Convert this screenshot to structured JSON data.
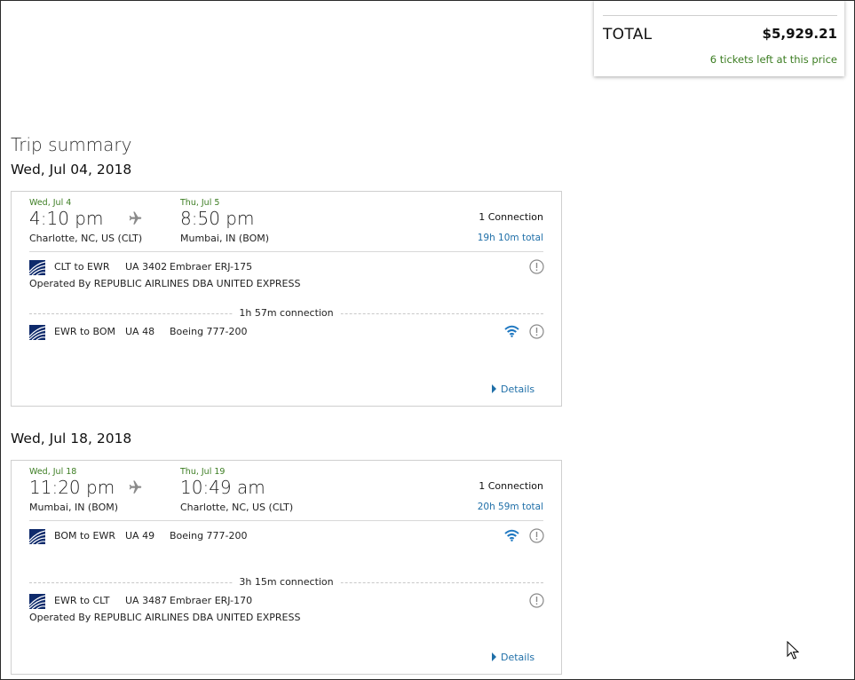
{
  "summary": {
    "total_label": "TOTAL",
    "total_amount": "$5,929.21",
    "tickets_left": "6 tickets left at this price"
  },
  "trip_summary_title": "Trip summary",
  "colors": {
    "green": "#3c7d22",
    "link_blue": "#1f6fa8",
    "united_blue": "#0e2a6b"
  },
  "trips": [
    {
      "date_heading": "Wed, Jul 04, 2018",
      "depart_day": "Wed, Jul 4",
      "depart_time": "4:10 pm",
      "depart_city": "Charlotte, NC, US (CLT)",
      "arrive_day": "Thu, Jul 5",
      "arrive_time": "8:50 pm",
      "arrive_city": "Mumbai, IN (BOM)",
      "connections": "1 Connection",
      "total_duration": "19h 10m total",
      "segments": [
        {
          "route": "CLT to EWR",
          "flight": "UA 3402",
          "aircraft": "Embraer ERJ-175",
          "operated_by": "Operated By REPUBLIC AIRLINES DBA UNITED EXPRESS",
          "wifi": false
        },
        {
          "route": "EWR to BOM",
          "flight": "UA 48",
          "aircraft": "Boeing 777-200",
          "operated_by": "",
          "wifi": true
        }
      ],
      "connection_label": "1h 57m connection",
      "details_label": "Details"
    },
    {
      "date_heading": "Wed, Jul 18, 2018",
      "depart_day": "Wed, Jul 18",
      "depart_time": "11:20 pm",
      "depart_city": "Mumbai, IN (BOM)",
      "arrive_day": "Thu, Jul 19",
      "arrive_time": "10:49 am",
      "arrive_city": "Charlotte, NC, US (CLT)",
      "connections": "1 Connection",
      "total_duration": "20h 59m total",
      "segments": [
        {
          "route": "BOM to EWR",
          "flight": "UA 49",
          "aircraft": "Boeing 777-200",
          "operated_by": "",
          "wifi": true
        },
        {
          "route": "EWR to CLT",
          "flight": "UA 3487",
          "aircraft": "Embraer ERJ-170",
          "operated_by": "Operated By REPUBLIC AIRLINES DBA UNITED EXPRESS",
          "wifi": false
        }
      ],
      "connection_label": "3h 15m connection",
      "details_label": "Details"
    }
  ],
  "icons": {
    "plane": "plane-icon",
    "logo": "united-globe-logo",
    "warning": "info-exclamation-icon",
    "wifi": "wifi-icon",
    "caret": "caret-right-icon",
    "cursor": "mouse-cursor"
  }
}
